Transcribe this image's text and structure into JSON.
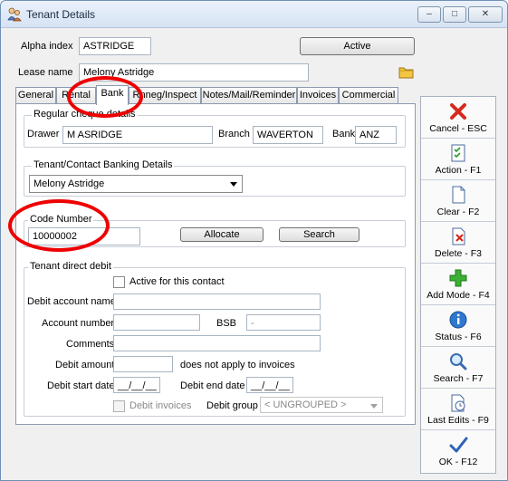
{
  "window": {
    "title": "Tenant Details",
    "controls": {
      "minimize": "–",
      "maximize": "□",
      "close": "✕"
    }
  },
  "header": {
    "alpha_index_label": "Alpha index",
    "alpha_index_value": "ASTRIDGE",
    "status_button": "Active",
    "lease_name_label": "Lease name",
    "lease_name_value": "Melony Astridge"
  },
  "tabs": [
    {
      "label": "General"
    },
    {
      "label": "Rental"
    },
    {
      "label": "Bank"
    },
    {
      "label": "Rnneg/Inspect"
    },
    {
      "label": "Notes/Mail/Reminder"
    },
    {
      "label": "Invoices"
    },
    {
      "label": "Commercial"
    }
  ],
  "regular_cheque": {
    "legend": "Regular cheque details",
    "drawer_label": "Drawer",
    "drawer_value": "M ASRIDGE",
    "branch_label": "Branch",
    "branch_value": "WAVERTON",
    "bank_label": "Bank",
    "bank_value": "ANZ"
  },
  "banking_details": {
    "legend": "Tenant/Contact Banking Details",
    "selected": "Melony Astridge"
  },
  "code": {
    "label": "Code Number",
    "value": "10000002",
    "allocate_button": "Allocate",
    "search_button": "Search"
  },
  "direct_debit": {
    "legend": "Tenant direct debit",
    "active_label": "Active for this contact",
    "account_name_label": "Debit account name",
    "account_number_label": "Account number",
    "bsb_label": "BSB",
    "bsb_value": "-",
    "comments_label": "Comments",
    "amount_label": "Debit amount",
    "amount_note": "does not apply to invoices",
    "start_date_label": "Debit start date",
    "start_date_value": "__/__/__",
    "end_date_label": "Debit end date",
    "end_date_value": "__/__/__",
    "invoices_label": "Debit invoices",
    "group_label": "Debit group",
    "group_value": "< UNGROUPED >"
  },
  "sidebar": [
    {
      "label": "Cancel - ESC",
      "icon": "cancel-x-icon"
    },
    {
      "label": "Action - F1",
      "icon": "action-checklist-icon"
    },
    {
      "label": "Clear - F2",
      "icon": "clear-page-icon"
    },
    {
      "label": "Delete - F3",
      "icon": "delete-page-icon"
    },
    {
      "label": "Add Mode - F4",
      "icon": "add-plus-icon"
    },
    {
      "label": "Status - F6",
      "icon": "info-icon"
    },
    {
      "label": "Search - F7",
      "icon": "magnifier-icon"
    },
    {
      "label": "Last Edits - F9",
      "icon": "history-page-icon"
    },
    {
      "label": "OK - F12",
      "icon": "checkmark-icon"
    }
  ],
  "colors": {
    "annotation_red": "#e00000",
    "window_border": "#6f8fb5"
  }
}
